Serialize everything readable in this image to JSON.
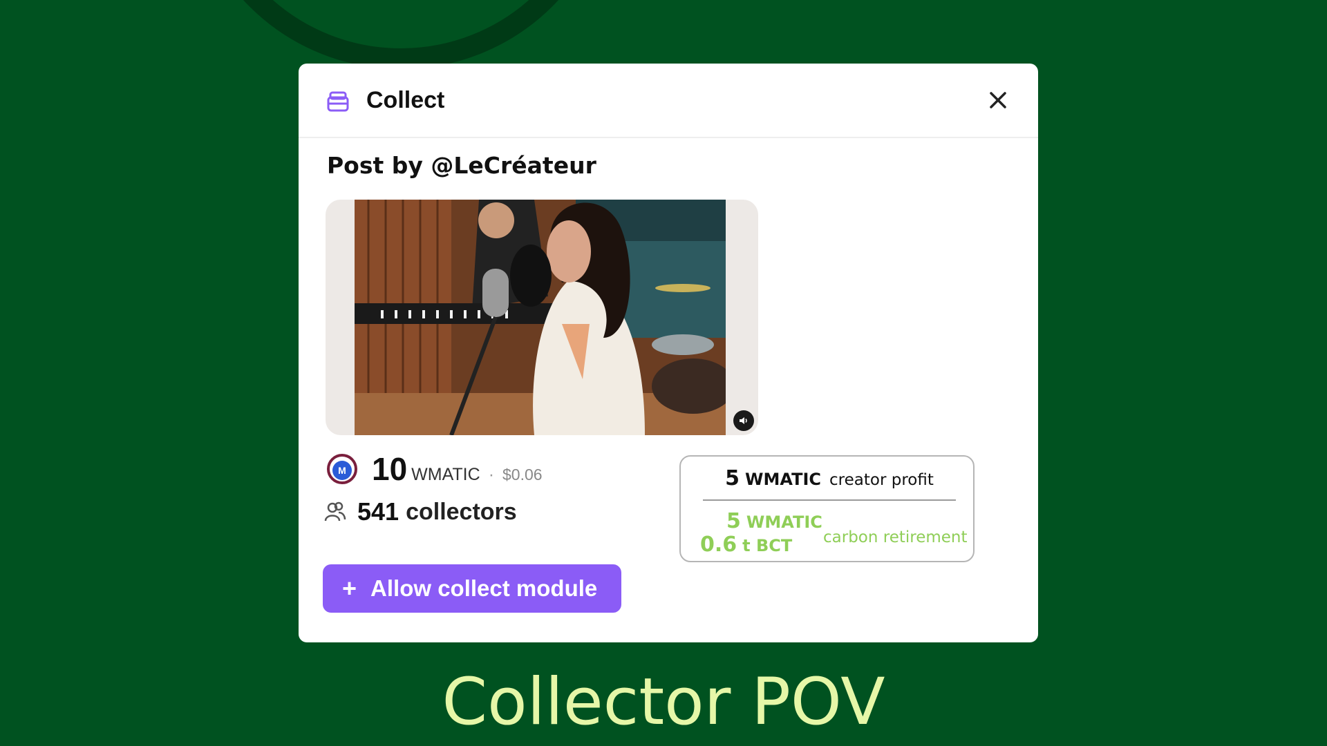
{
  "modal": {
    "title": "Collect",
    "icon": "collect-icon",
    "close_icon": "close-icon"
  },
  "post": {
    "by_label": "Post by @LeCréateur",
    "media": "recording-studio-singer-photo",
    "mute_icon": "speaker-icon"
  },
  "price": {
    "icon": "wmatic-token-icon",
    "amount": "10",
    "currency": "WMATIC",
    "separator": "·",
    "usd": "$0.06"
  },
  "collectors": {
    "icon": "people-icon",
    "count": "541",
    "label": "collectors"
  },
  "action": {
    "plus": "+",
    "label": "Allow collect module"
  },
  "split": {
    "creator": {
      "amount": "5",
      "unit": "WMATIC",
      "label": "creator profit"
    },
    "carbon": {
      "amount": "5",
      "unit": "WMATIC",
      "tonnes": "0.6",
      "tonnes_unit": "t BCT",
      "label": "carbon retirement"
    }
  },
  "colors": {
    "background": "#005220",
    "accent": "#8b5cf6",
    "carbon_green": "#8fce57",
    "caption": "#e6f7a8"
  },
  "caption": "Collector POV"
}
